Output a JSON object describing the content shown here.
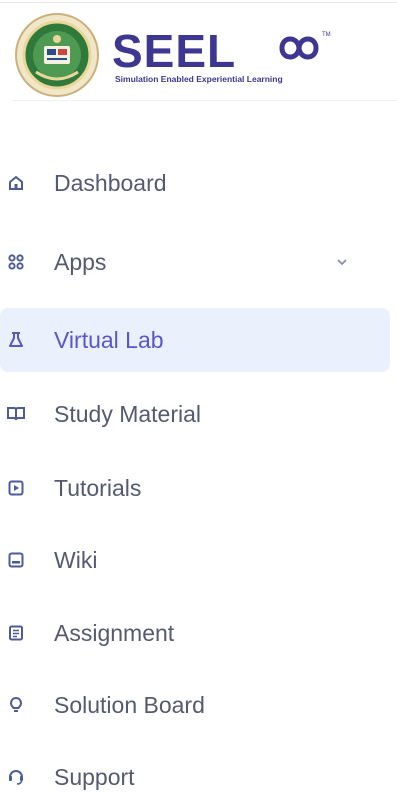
{
  "brand": {
    "logo_text": "SEEL",
    "tagline": "Simulation Enabled Experiential Learning",
    "colors": {
      "brand": "#3e3791",
      "accent": "#5a56c8"
    }
  },
  "nav": {
    "items": [
      {
        "label": "Dashboard",
        "icon": "home-icon"
      },
      {
        "label": "Apps",
        "icon": "apps-grid-icon",
        "has_dropdown": true
      },
      {
        "label": "Virtual Lab",
        "icon": "flask-icon",
        "active": true
      },
      {
        "label": "Study Material",
        "icon": "book-open-icon"
      },
      {
        "label": "Tutorials",
        "icon": "play-square-icon"
      },
      {
        "label": "Wiki",
        "icon": "wiki-book-icon"
      },
      {
        "label": "Assignment",
        "icon": "document-icon"
      },
      {
        "label": "Solution Board",
        "icon": "lightbulb-icon"
      },
      {
        "label": "Support",
        "icon": "support-icon"
      }
    ]
  }
}
